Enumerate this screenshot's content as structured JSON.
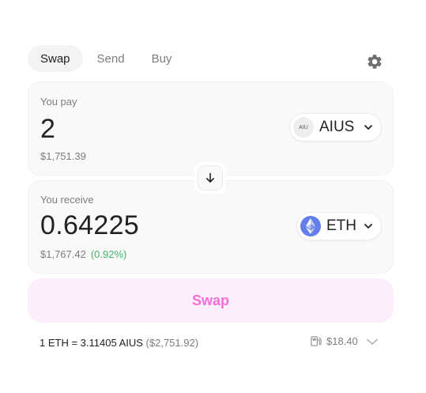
{
  "tabs": [
    {
      "label": "Swap",
      "active": true
    },
    {
      "label": "Send",
      "active": false
    },
    {
      "label": "Buy",
      "active": false
    }
  ],
  "settings_icon": "gear-icon",
  "pay": {
    "label": "You pay",
    "amount": "2",
    "usd_value": "$1,751.39",
    "token": {
      "symbol": "AIUS",
      "icon_text": "AIU"
    }
  },
  "switch_icon": "arrow-down-icon",
  "receive": {
    "label": "You receive",
    "amount": "0.64225",
    "usd_value": "$1,767.42",
    "usd_change": "(0.92%)",
    "token": {
      "symbol": "ETH",
      "icon": "ethereum-icon"
    }
  },
  "swap_button": {
    "label": "Swap"
  },
  "rate": {
    "text": "1 ETH = 3.11405 AIUS",
    "usd": "($2,751.92)"
  },
  "gas": {
    "icon": "gas-pump-icon",
    "value": "$18.40"
  },
  "colors": {
    "accent_pink": "#f76ed9",
    "swap_bg": "#fdeefb",
    "positive_green": "#40b66b",
    "eth_blue": "#627eea"
  }
}
